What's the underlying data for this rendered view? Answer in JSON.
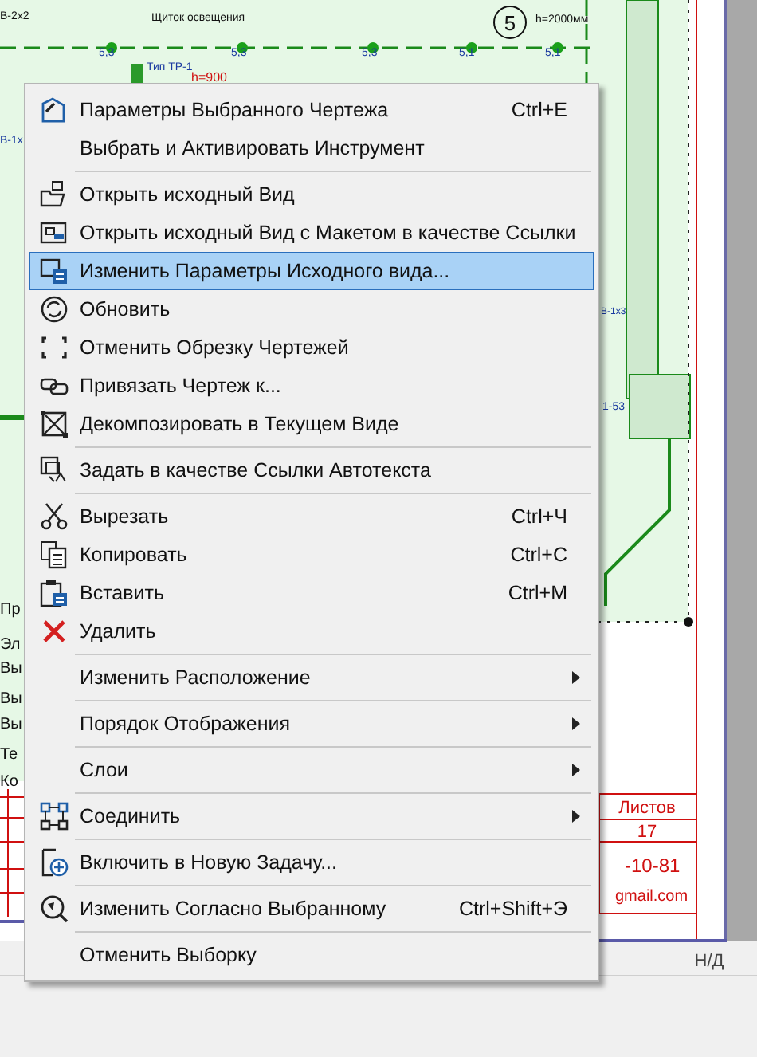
{
  "drawing": {
    "labels": [
      {
        "text": "В-2х2",
        "kind": "tag"
      },
      {
        "text": "Щиток освещения",
        "kind": "tag"
      },
      {
        "text": "5",
        "kind": "circle"
      },
      {
        "text": "h=2000мм",
        "kind": "tag"
      },
      {
        "text": "5,3",
        "kind": "tag"
      },
      {
        "text": "5,3",
        "kind": "tag"
      },
      {
        "text": "5,3",
        "kind": "tag"
      },
      {
        "text": "5,1",
        "kind": "tag"
      },
      {
        "text": "5,1",
        "kind": "tag"
      },
      {
        "text": "Тип ТР-1",
        "kind": "tag"
      },
      {
        "text": "h=900",
        "kind": "red"
      },
      {
        "text": "В-1х",
        "kind": "tag"
      },
      {
        "text": "В-1х3",
        "kind": "tag"
      },
      {
        "text": "1-53",
        "kind": "tag"
      },
      {
        "text": "Пр",
        "kind": "note"
      },
      {
        "text": "Эл",
        "kind": "note"
      },
      {
        "text": "Вы",
        "kind": "note"
      },
      {
        "text": "Вы",
        "kind": "note"
      },
      {
        "text": "Вы",
        "kind": "note"
      },
      {
        "text": "Те",
        "kind": "note"
      },
      {
        "text": "Ко",
        "kind": "note"
      }
    ]
  },
  "title_block": {
    "cells": [
      "Листов",
      "17",
      "-10-81",
      "gmail.com"
    ]
  },
  "status_bar": {
    "text": "Н/Д"
  },
  "menu": {
    "items": [
      {
        "kind": "item",
        "label": "Параметры Выбранного Чертежа",
        "shortcut": "Ctrl+E",
        "submenu": false,
        "selected": false
      },
      {
        "kind": "item",
        "label": "Выбрать и Активировать Инструмент",
        "submenu": false,
        "selected": false
      },
      {
        "kind": "separator"
      },
      {
        "kind": "item",
        "label": "Открыть исходный Вид",
        "submenu": false,
        "selected": false
      },
      {
        "kind": "item",
        "label": "Открыть исходный Вид с Макетом в качестве Ссылки",
        "submenu": false,
        "selected": false
      },
      {
        "kind": "item",
        "label": "Изменить Параметры Исходного вида...",
        "submenu": false,
        "selected": true
      },
      {
        "kind": "item",
        "label": "Обновить",
        "submenu": false,
        "selected": false
      },
      {
        "kind": "item",
        "label": "Отменить Обрезку Чертежей",
        "submenu": false,
        "selected": false
      },
      {
        "kind": "item",
        "label": "Привязать Чертеж к...",
        "submenu": false,
        "selected": false
      },
      {
        "kind": "item",
        "label": "Декомпозировать в Текущем Виде",
        "submenu": false,
        "selected": false
      },
      {
        "kind": "separator"
      },
      {
        "kind": "item",
        "label": "Задать в качестве Ссылки Автотекста",
        "submenu": false,
        "selected": false
      },
      {
        "kind": "separator"
      },
      {
        "kind": "item",
        "label": "Вырезать",
        "shortcut": "Ctrl+Ч",
        "submenu": false,
        "selected": false
      },
      {
        "kind": "item",
        "label": "Копировать",
        "shortcut": "Ctrl+C",
        "submenu": false,
        "selected": false
      },
      {
        "kind": "item",
        "label": "Вставить",
        "shortcut": "Ctrl+M",
        "submenu": false,
        "selected": false
      },
      {
        "kind": "item",
        "label": "Удалить",
        "submenu": false,
        "selected": false
      },
      {
        "kind": "separator"
      },
      {
        "kind": "item",
        "label": "Изменить Расположение",
        "submenu": true,
        "selected": false
      },
      {
        "kind": "separator"
      },
      {
        "kind": "item",
        "label": "Порядок Отображения",
        "submenu": true,
        "selected": false
      },
      {
        "kind": "separator"
      },
      {
        "kind": "item",
        "label": "Слои",
        "submenu": true,
        "selected": false
      },
      {
        "kind": "separator"
      },
      {
        "kind": "item",
        "label": "Соединить",
        "submenu": true,
        "selected": false
      },
      {
        "kind": "separator"
      },
      {
        "kind": "item",
        "label": "Включить в Новую Задачу...",
        "submenu": false,
        "selected": false
      },
      {
        "kind": "separator"
      },
      {
        "kind": "item",
        "label": "Изменить Согласно Выбранному",
        "shortcut": "Ctrl+Shift+Э",
        "submenu": false,
        "selected": false
      },
      {
        "kind": "separator"
      },
      {
        "kind": "item",
        "label": "Отменить Выборку",
        "submenu": false,
        "selected": false
      }
    ]
  }
}
